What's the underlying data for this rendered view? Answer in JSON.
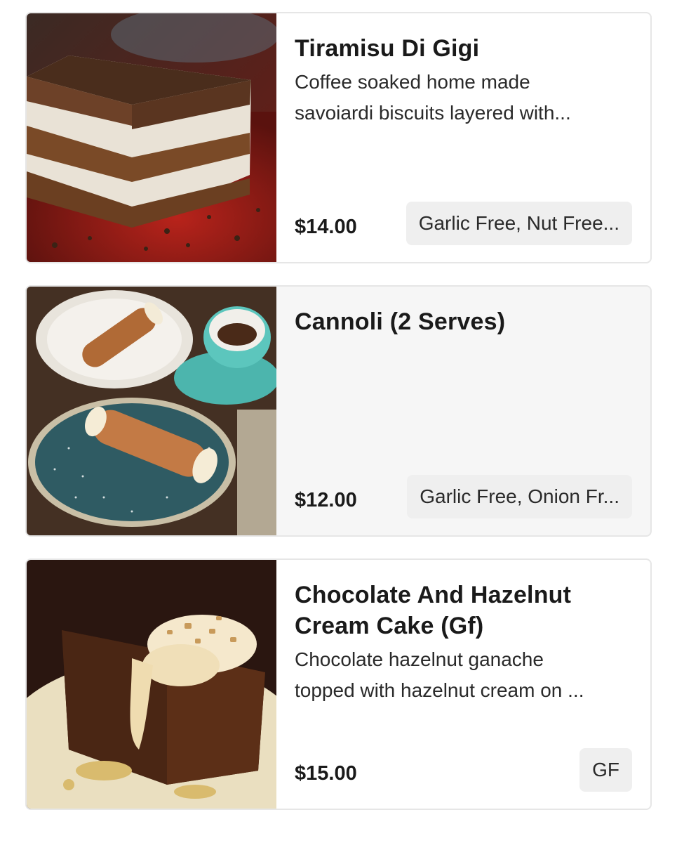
{
  "menu_items": [
    {
      "name": "Tiramisu Di Gigi",
      "description_lines": [
        "Coffee soaked home made",
        "savoiardi biscuits layered with..."
      ],
      "price": "$14.00",
      "dietary_tags": "Garlic Free, Nut Free..."
    },
    {
      "name": "Cannoli (2 Serves)",
      "description_lines": [],
      "price": "$12.00",
      "dietary_tags": "Garlic Free, Onion Fr..."
    },
    {
      "name_lines": [
        "Chocolate And Hazelnut",
        "Cream Cake (Gf)"
      ],
      "description_lines": [
        "Chocolate hazelnut ganache",
        "topped with hazelnut cream on ..."
      ],
      "price": "$15.00",
      "dietary_tags": "GF"
    }
  ]
}
